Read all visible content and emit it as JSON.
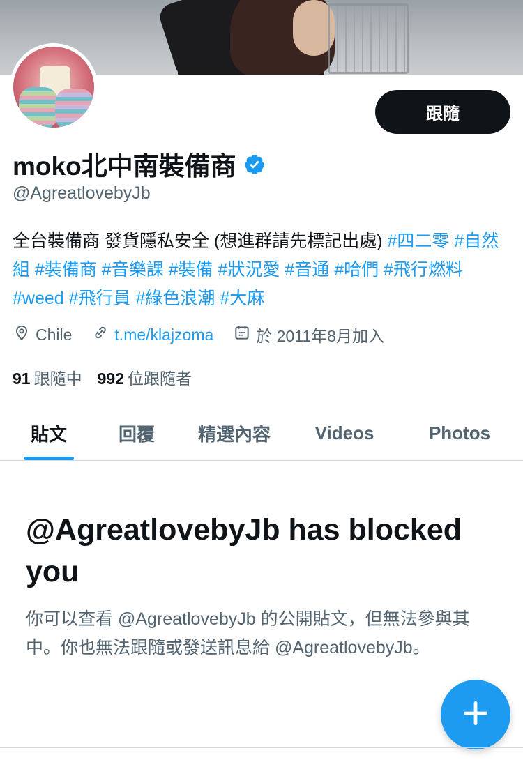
{
  "banner": {
    "description_icon": "banner-image"
  },
  "profile": {
    "display_name": "moko北中南裝備商",
    "handle": "@AgreatlovebyJb",
    "follow_label": "跟隨",
    "bio_text": "全台裝備商 發貨隱私安全 (想進群請先標記出處) ",
    "bio_tags": "#四二零 #自然組 #裝備商 #音樂課 #裝備 #狀況愛 #音通 #哈們 #飛行燃料 #weed #飛行員 #綠色浪潮 #大麻",
    "location": "Chile",
    "link": "t.me/klajzoma",
    "joined": "於 2011年8月加入",
    "following_count": "91",
    "following_label": "跟隨中",
    "followers_count": "992",
    "followers_label": "位跟隨者"
  },
  "tabs": [
    "貼文",
    "回覆",
    "精選內容",
    "Videos",
    "Photos"
  ],
  "blocked": {
    "title": "@AgreatlovebyJb has blocked you",
    "description": "你可以查看 @AgreatlovebyJb 的公開貼文，但無法參與其中。你也無法跟隨或發送訊息給 @AgreatlovebyJb。"
  },
  "colors": {
    "accent": "#1d9bf0",
    "text": "#0f1419",
    "secondary": "#536471"
  },
  "icons": [
    "location-icon",
    "link-icon",
    "calendar-icon",
    "verified-badge-icon",
    "compose-plus-icon"
  ]
}
